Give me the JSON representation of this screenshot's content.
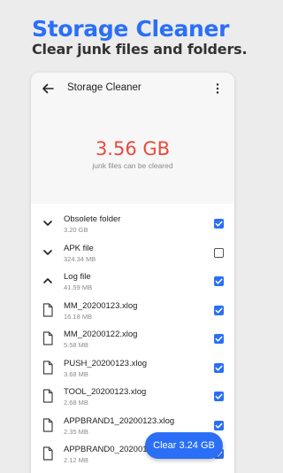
{
  "promo": {
    "title": "Storage Cleaner",
    "subtitle": "Clear junk files and folders."
  },
  "appbar": {
    "title": "Storage Cleaner"
  },
  "summary": {
    "size": "3.56 GB",
    "caption": "junk files can be cleared"
  },
  "items": [
    {
      "name": "Obsolete folder",
      "size": "3.20 GB",
      "icon": "chevron-down-icon",
      "checked": true
    },
    {
      "name": "APK file",
      "size": "324.34 MB",
      "icon": "chevron-down-icon",
      "checked": false
    },
    {
      "name": "Log file",
      "size": "41.59 MB",
      "icon": "chevron-up-icon",
      "checked": true
    },
    {
      "name": "MM_20200123.xlog",
      "size": "16.18 MB",
      "icon": "file-icon",
      "checked": true
    },
    {
      "name": "MM_20200122.xlog",
      "size": "5.58 MB",
      "icon": "file-icon",
      "checked": true
    },
    {
      "name": "PUSH_20200123.xlog",
      "size": "3.68 MB",
      "icon": "file-icon",
      "checked": true
    },
    {
      "name": "TOOL_20200123.xlog",
      "size": "2.68 MB",
      "icon": "file-icon",
      "checked": true
    },
    {
      "name": "APPBRAND1_20200123.xlog",
      "size": "2.35 MB",
      "icon": "file-icon",
      "checked": true
    },
    {
      "name": "APPBRAND0_20200123.xlog",
      "size": "2.12 MB",
      "icon": "file-icon",
      "checked": true
    }
  ],
  "action": {
    "clear_label": "Clear 3.24 GB"
  },
  "colors": {
    "accent": "#2a6ff6",
    "junk": "#e84a3c"
  }
}
